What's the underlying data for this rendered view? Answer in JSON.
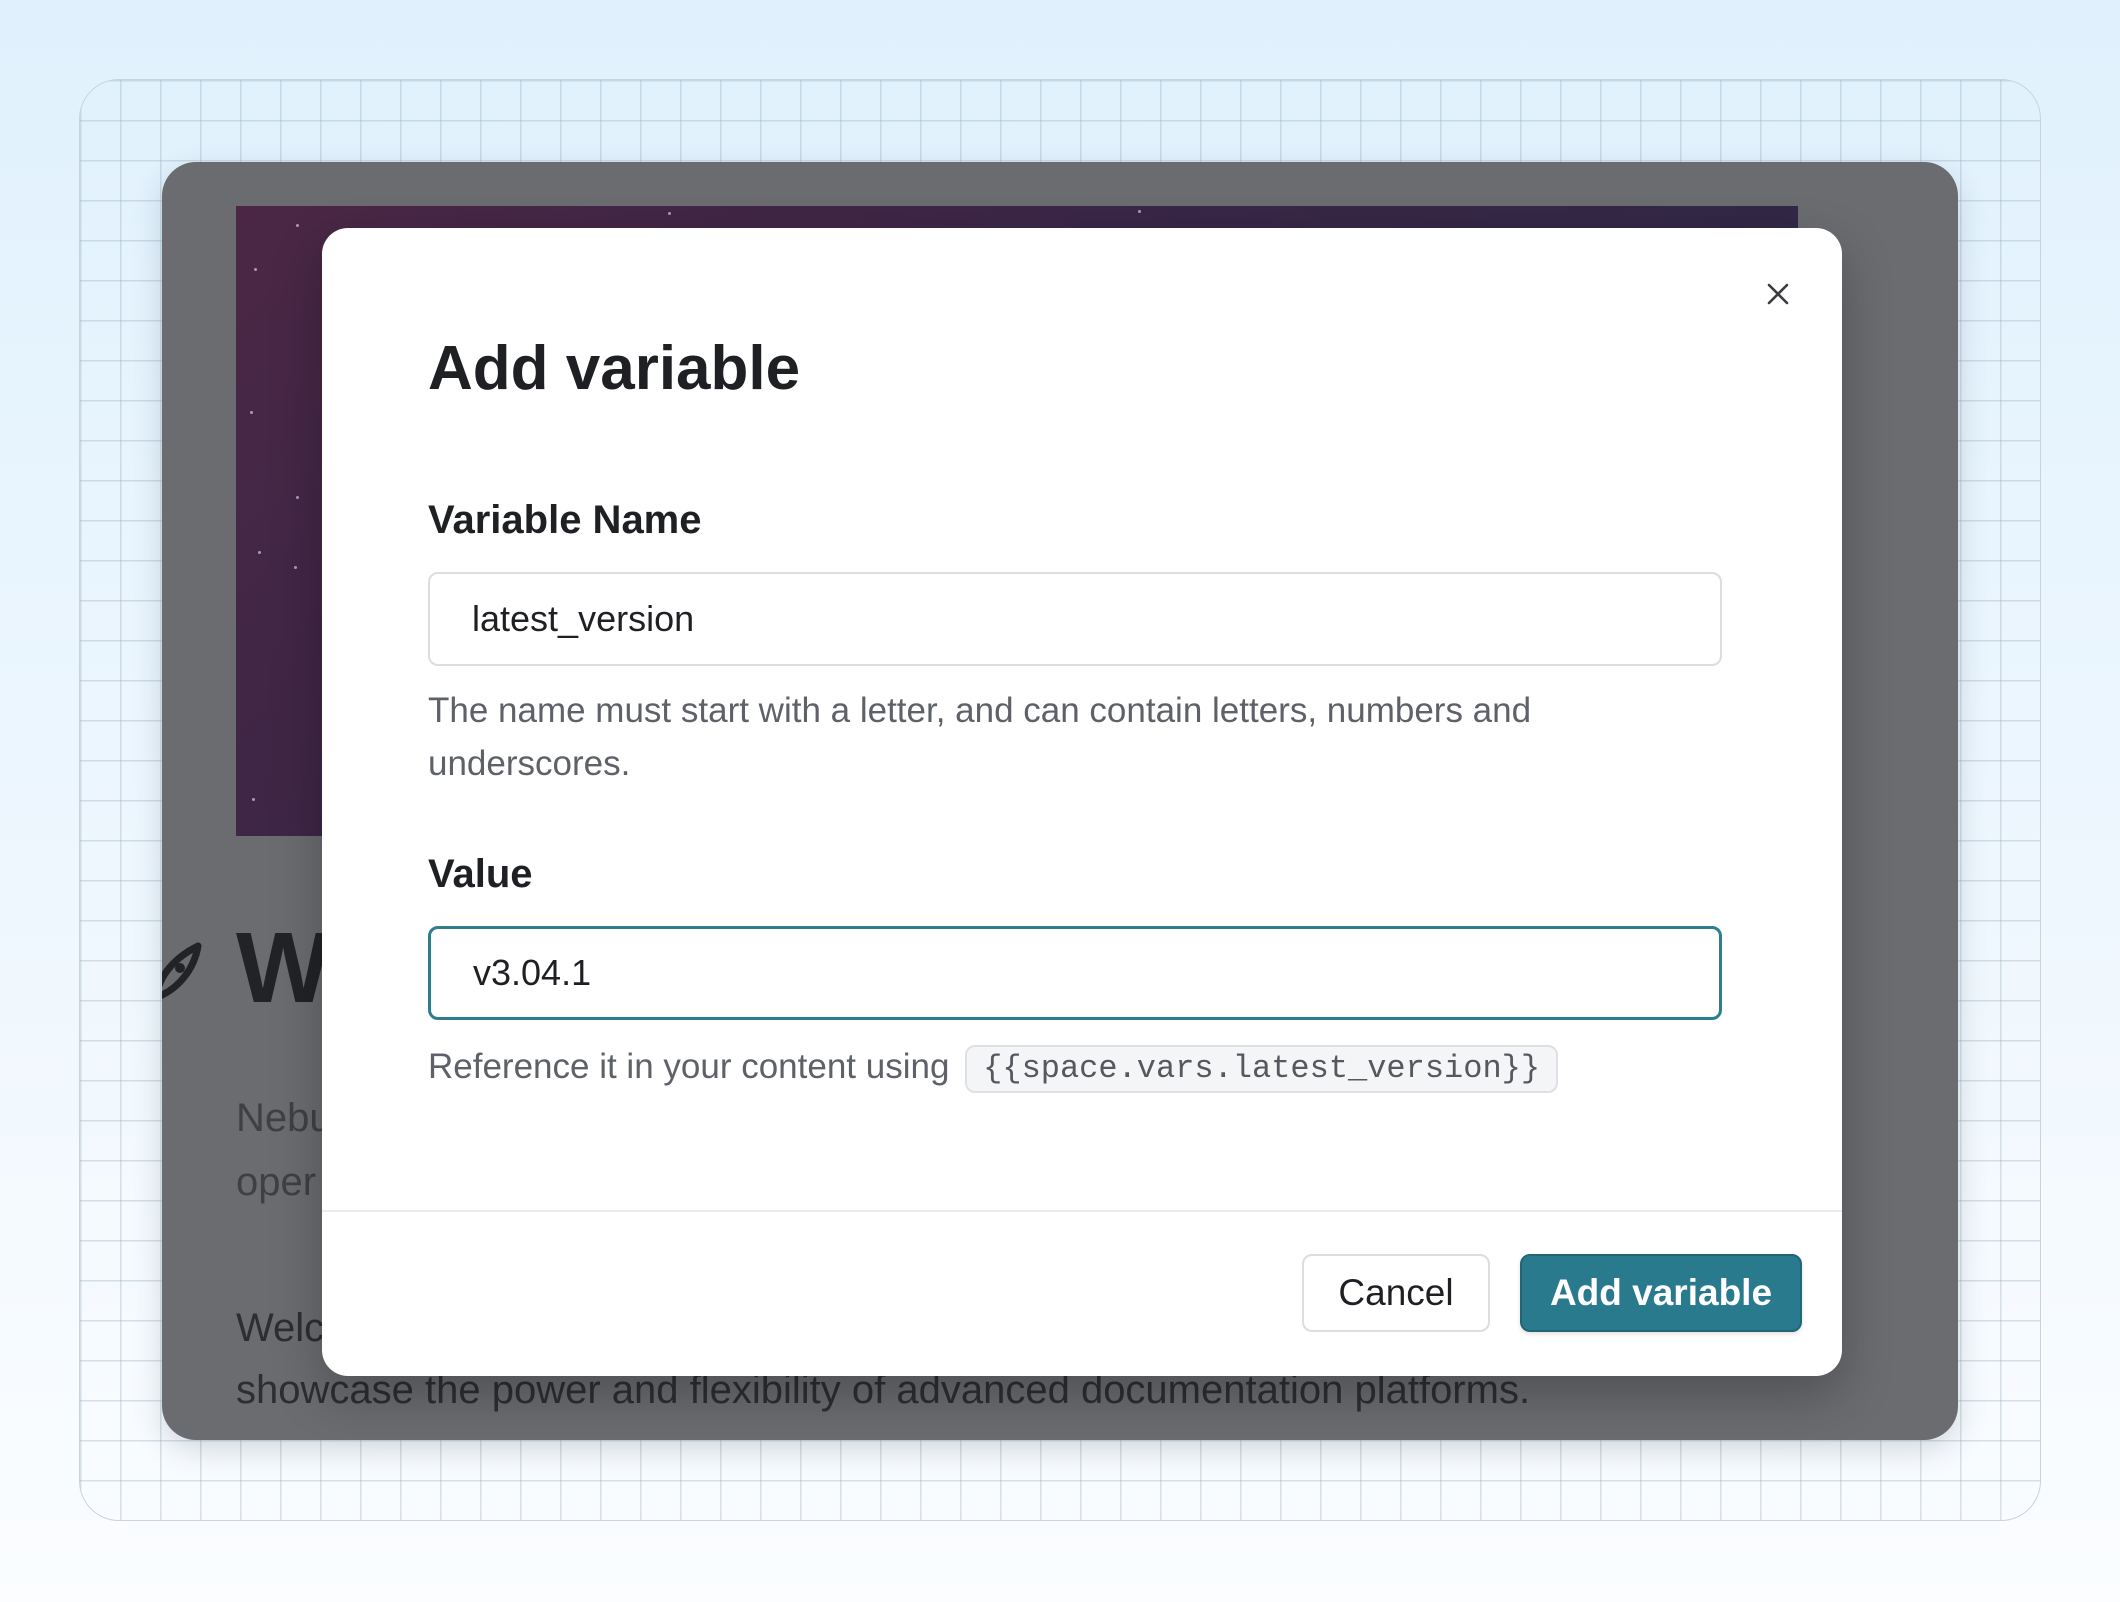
{
  "background_page": {
    "heading_partial": "W",
    "intro_line1_partial": "Nebu",
    "intro_line2_partial": "oper",
    "body_line1_partial": "Welc",
    "body_line2": "showcase the power and flexibility of advanced documentation platforms."
  },
  "modal": {
    "title": "Add variable",
    "close_icon": "close-icon",
    "name_field": {
      "label": "Variable Name",
      "value": "latest_version",
      "helper": "The name must start with a letter, and can contain letters, numbers and underscores."
    },
    "value_field": {
      "label": "Value",
      "value": "v3.04.1",
      "helper_prefix": "Reference it in your content using",
      "reference_code": "{{space.vars.latest_version}}"
    },
    "buttons": {
      "cancel": "Cancel",
      "submit": "Add variable"
    }
  },
  "colors": {
    "primary": "#2a7a8e",
    "focus_border": "#2d7f90",
    "overlay": "#6b6c70"
  }
}
